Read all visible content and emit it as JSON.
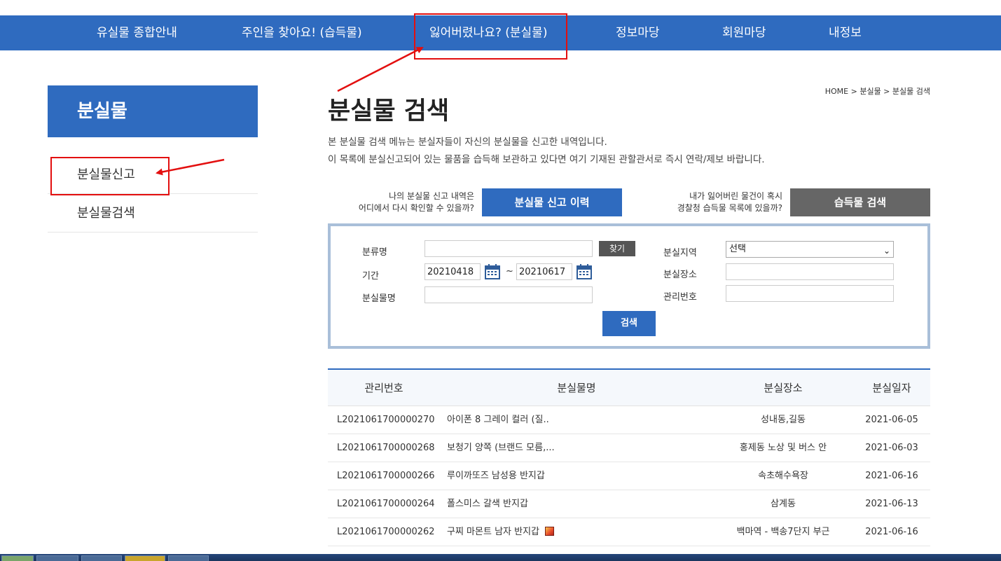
{
  "topnav": {
    "items": [
      {
        "label": "유실물 종합안내"
      },
      {
        "label": "주인을 찾아요! (습득물)"
      },
      {
        "label": "잃어버렸나요? (분실물)"
      },
      {
        "label": "정보마당"
      },
      {
        "label": "회원마당"
      },
      {
        "label": "내정보"
      }
    ]
  },
  "sidebar": {
    "title": "분실물",
    "items": [
      {
        "label": "분실물신고"
      },
      {
        "label": "분실물검색"
      }
    ]
  },
  "breadcrumb": "HOME > 분실물 > 분실물 검색",
  "page_title": "분실물 검색",
  "description": [
    "본 분실물 검색 메뉴는 분실자들이 자신의 분실물을 신고한 내역입니다.",
    "이 목록에 분실신고되어 있는 물품을 습득해 보관하고 있다면 여기 기재된 관할관서로 즉시 연락/제보 바랍니다."
  ],
  "quick": {
    "left_text_1": "나의 분실물 신고 내역은",
    "left_text_2": "어디에서 다시 확인할 수 있을까?",
    "left_button": "분실물 신고 이력",
    "right_text_1": "내가 잃어버린 물건이 혹시",
    "right_text_2": "경찰청 습득물 목록에 있을까?",
    "right_button": "습득물 검색"
  },
  "search": {
    "category_label": "분류명",
    "category_value": "",
    "find_button": "찾기",
    "period_label": "기간",
    "date_from": "20210418",
    "date_to": "20210617",
    "tilde": "~",
    "item_name_label": "분실물명",
    "item_name_value": "",
    "region_label": "분실지역",
    "region_selected": "선택",
    "place_label": "분실장소",
    "place_value": "",
    "manage_no_label": "관리번호",
    "manage_no_value": "",
    "search_button": "검색"
  },
  "table": {
    "headers": [
      "관리번호",
      "분실물명",
      "분실장소",
      "분실일자"
    ],
    "rows": [
      {
        "id": "L2021061700000270",
        "name": "아이폰 8 그레이 컬러 (질..",
        "place": "성내동,길동",
        "date": "2021-06-05",
        "has_image": false
      },
      {
        "id": "L2021061700000268",
        "name": "보청기 양쪽 (브랜드 모름,...",
        "place": "홍제동 노상 및 버스 안",
        "date": "2021-06-03",
        "has_image": false
      },
      {
        "id": "L2021061700000266",
        "name": "루이까또즈 남성용 반지갑",
        "place": "속초해수욕장",
        "date": "2021-06-16",
        "has_image": false
      },
      {
        "id": "L2021061700000264",
        "name": "폴스미스 갈색 반지갑",
        "place": "삼계동",
        "date": "2021-06-13",
        "has_image": false
      },
      {
        "id": "L2021061700000262",
        "name": "구찌 마몬트 남자 반지갑",
        "place": "백마역 - 백송7단지 부근",
        "date": "2021-06-16",
        "has_image": true
      }
    ]
  },
  "colors": {
    "primary": "#2f6bbf",
    "gray_button": "#666666",
    "annotation_red": "#e30f0f",
    "search_border": "#a9bfd9"
  },
  "icons": {
    "calendar": "calendar-icon",
    "select_arrow": "chevron-down-icon",
    "thumbnail": "image-thumbnail-icon"
  }
}
